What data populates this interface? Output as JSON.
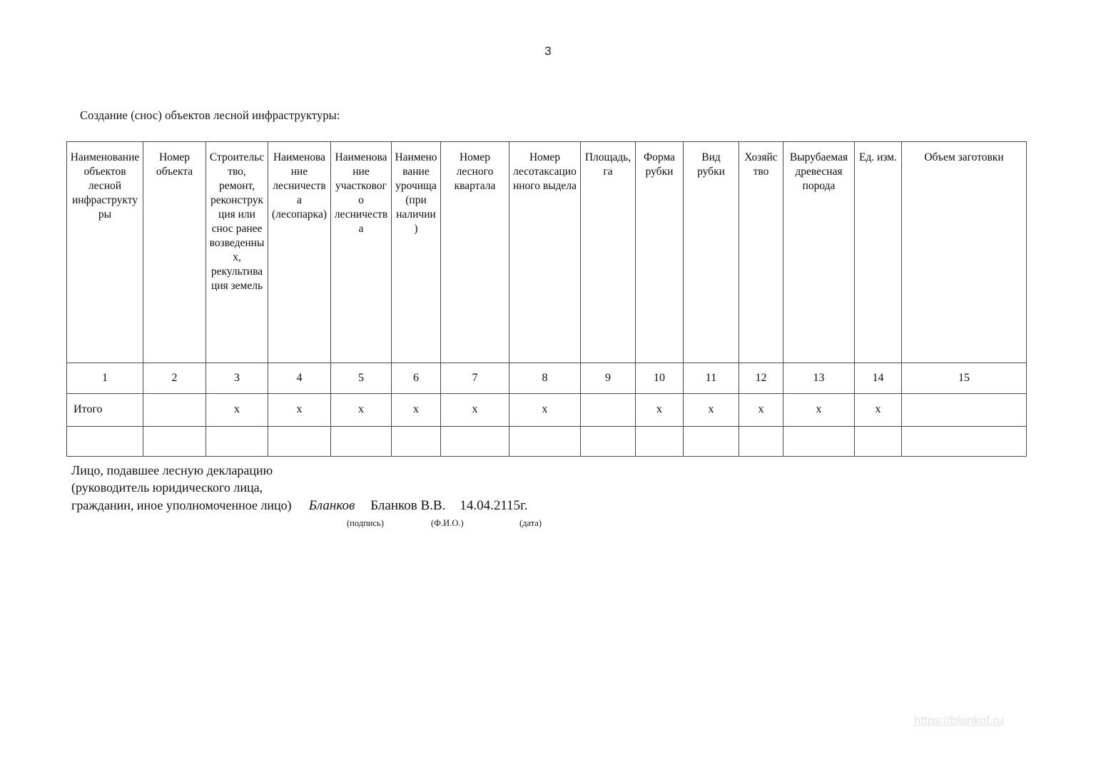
{
  "page": {
    "number": "3",
    "caption": "Создание (снос) объектов лесной инфраструктуры:",
    "watermark": "https://blankof.ru"
  },
  "table": {
    "headers": [
      "Наименование объектов лесной инфраструктуры",
      "Номер объекта",
      "Строительство, ремонт, реконструкция или снос ранее возведенных, рекультивация земель",
      "Наименование лесничества (лесопарка)",
      "Наименование участкового лесничества",
      "Наименование урочища (при наличии)",
      "Номер лесного квартала",
      "Номер лесотаксационного выдела",
      "Площадь, га",
      "Форма рубки",
      "Вид рубки",
      "Хозяйство",
      "Вырубаемая древесная порода",
      "Ед. изм.",
      "Объем заготовки"
    ],
    "column_numbers": [
      "1",
      "2",
      "3",
      "4",
      "5",
      "6",
      "7",
      "8",
      "9",
      "10",
      "11",
      "12",
      "13",
      "14",
      "15"
    ],
    "total_row": [
      "Итого",
      "",
      "x",
      "x",
      "x",
      "x",
      "x",
      "x",
      "",
      "x",
      "x",
      "x",
      "x",
      "x",
      ""
    ],
    "blank_row": [
      "",
      "",
      "",
      "",
      "",
      "",
      "",
      "",
      "",
      "",
      "",
      "",
      "",
      "",
      ""
    ]
  },
  "signature": {
    "line1": "Лицо, подавшее лесную декларацию",
    "line2": " (руководитель юридического лица,",
    "line3": "гражданин, иное уполномоченное лицо)",
    "signature_script": "Бланков",
    "fio_value": "Бланков В.В.",
    "date_value": "14.04.2115г.",
    "caption_signature": "(подпись)",
    "caption_fio": "(Ф.И.О.)",
    "caption_date": "(дата)"
  }
}
